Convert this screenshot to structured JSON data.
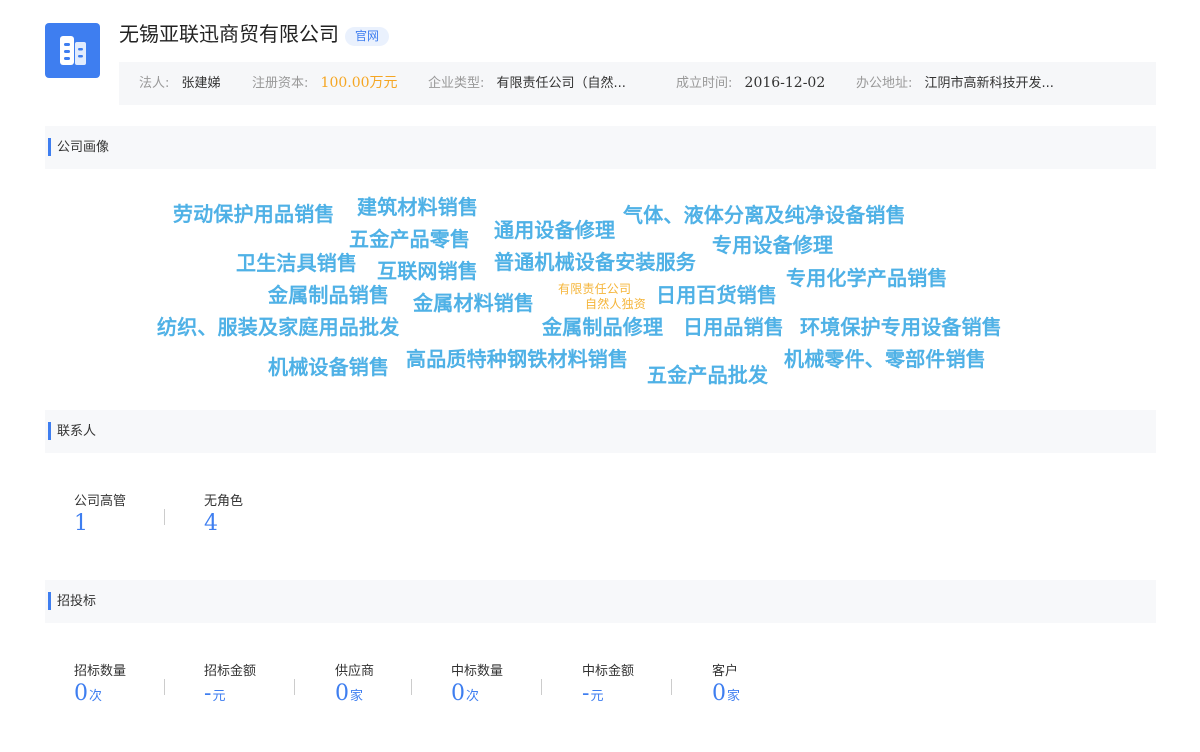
{
  "header": {
    "company_name": "无锡亚联迅商贸有限公司",
    "badge": "官网",
    "info": [
      {
        "label": "法人:",
        "value": "张建娣"
      },
      {
        "label": "注册资本:",
        "value": "100.00万元"
      },
      {
        "label": "企业类型:",
        "value": "有限责任公司（自然..."
      },
      {
        "label": "成立时间:",
        "value": "2016-12-02"
      },
      {
        "label": "办公地址:",
        "value": "江阴市高新科技开发..."
      }
    ]
  },
  "sections": {
    "portrait": "公司画像",
    "contacts": "联系人",
    "bidding": "招投标"
  },
  "word_cloud": [
    "劳动保护用品销售",
    "建筑材料销售",
    "通用设备修理",
    "气体、液体分离及纯净设备销售",
    "五金产品零售",
    "专用设备修理",
    "卫生洁具销售",
    "互联网销售",
    "普通机械设备安装服务",
    "专用化学产品销售",
    "金属制品销售",
    "金属材料销售",
    "有限责任公司",
    "自然人独资",
    "日用百货销售",
    "纺织、服装及家庭用品批发",
    "金属制品修理",
    "日用品销售",
    "环境保护专用设备销售",
    "机械设备销售",
    "高品质特种钢铁材料销售",
    "机械零件、零部件销售",
    "五金产品批发"
  ],
  "contacts": [
    {
      "label": "公司高管",
      "value": "1"
    },
    {
      "label": "无角色",
      "value": "4"
    }
  ],
  "bidding": [
    {
      "label": "招标数量",
      "value": "0",
      "unit": "次"
    },
    {
      "label": "招标金额",
      "value": "-",
      "unit": "元"
    },
    {
      "label": "供应商",
      "value": "0",
      "unit": "家"
    },
    {
      "label": "中标数量",
      "value": "0",
      "unit": "次"
    },
    {
      "label": "中标金额",
      "value": "-",
      "unit": "元"
    },
    {
      "label": "客户",
      "value": "0",
      "unit": "家"
    }
  ],
  "colors": {
    "accent": "#3e7ef0",
    "word_cloud": "#4fb1e6",
    "highlight": "#f5a623"
  }
}
